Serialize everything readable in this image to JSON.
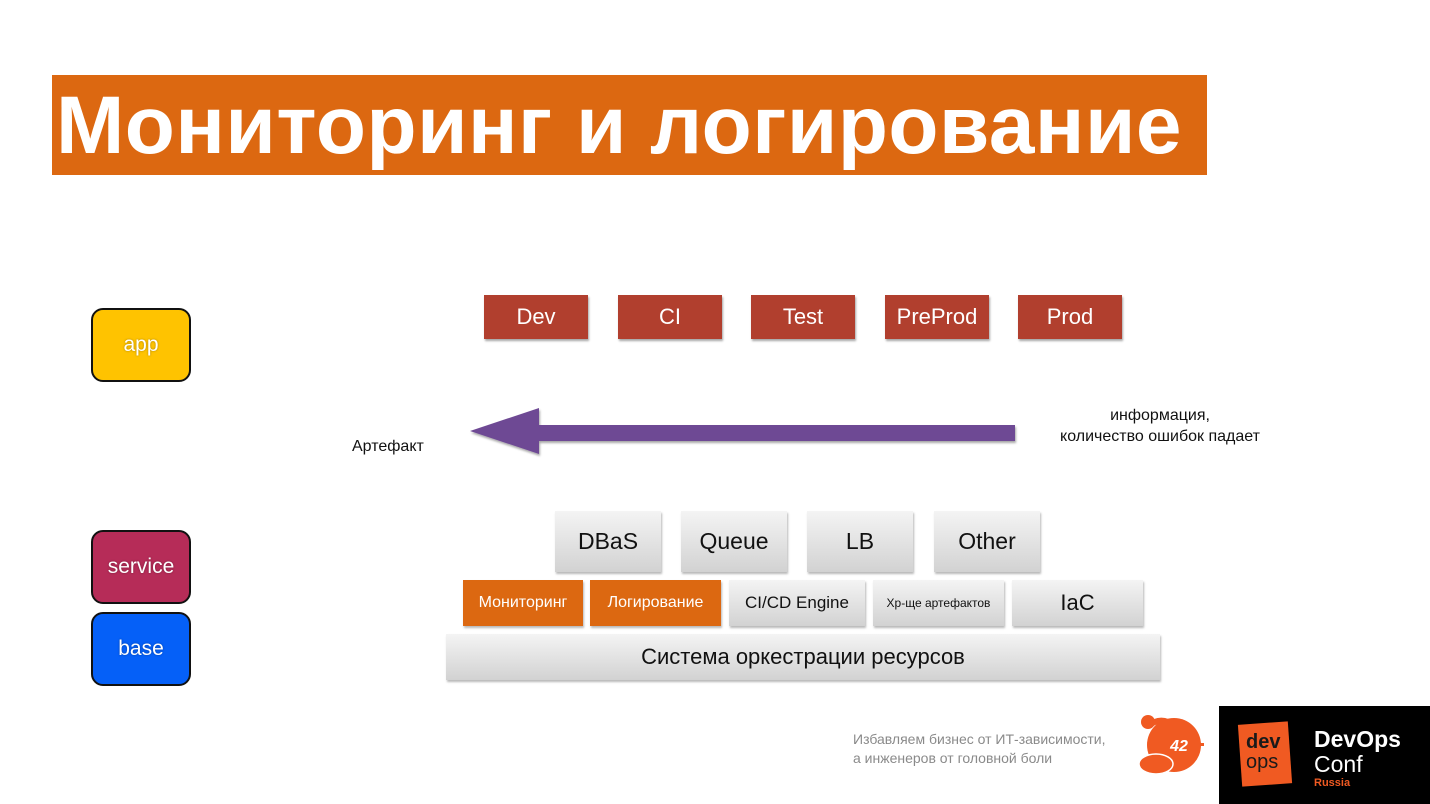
{
  "title": "Мониторинг и логирование",
  "colors": {
    "title_bg": "#dc6811",
    "env_box": "#b13f2e",
    "arrow": "#6e4a94",
    "app": "#ffc300",
    "service": "#b62c58",
    "base": "#0560f8",
    "highlight": "#dc6811",
    "brand": "#f05a22"
  },
  "layers": [
    {
      "label": "app"
    },
    {
      "label": "service"
    },
    {
      "label": "base"
    }
  ],
  "environments": [
    "Dev",
    "CI",
    "Test",
    "PreProd",
    "Prod"
  ],
  "flow": {
    "left_label": "Артефакт",
    "right_label_line1": "информация,",
    "right_label_line2": "количество ошибок падает",
    "direction": "right-to-left"
  },
  "services": [
    "DBaS",
    "Queue",
    "LB",
    "Other"
  ],
  "platform": [
    {
      "label": "Мониторинг",
      "highlighted": true
    },
    {
      "label": "Логирование",
      "highlighted": true
    },
    {
      "label": "CI/CD Engine",
      "highlighted": false
    },
    {
      "label": "Хр-ще артефактов",
      "highlighted": false
    },
    {
      "label": "IaC",
      "highlighted": false
    }
  ],
  "orchestration": "Система оркестрации ресурсов",
  "footer": {
    "slogan_line1": "Избавляем бизнес от ИТ-зависимости,",
    "slogan_line2": "а инженеров от головной боли",
    "page_number": "42",
    "logo": {
      "mark_top": "dev",
      "mark_bottom": "ops",
      "name_line1": "DevOps",
      "name_line2": "Conf",
      "name_line3": "Russia"
    }
  }
}
